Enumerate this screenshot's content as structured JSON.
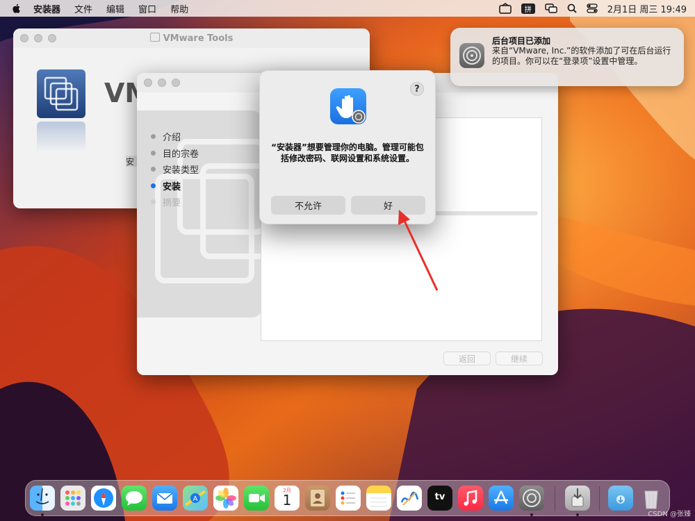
{
  "menubar": {
    "app_name": "安装器",
    "items": [
      "文件",
      "编辑",
      "窗口",
      "帮助"
    ],
    "ime": "拼",
    "datetime": "2月1日 周三  19:49"
  },
  "vmware_window": {
    "title": "VMware Tools",
    "brand_partial": "VM",
    "label_partial": "安"
  },
  "installer": {
    "steps": [
      {
        "label": "介绍",
        "state": "done"
      },
      {
        "label": "目的宗卷",
        "state": "done"
      },
      {
        "label": "安装类型",
        "state": "done"
      },
      {
        "label": "安装",
        "state": "current"
      },
      {
        "label": "摘要",
        "state": "disabled"
      }
    ],
    "back_label": "返回",
    "continue_label": "继续"
  },
  "dialog": {
    "help": "?",
    "message": "“安装器”想要管理你的电脑。管理可能包括修改密码、联网设置和系统设置。",
    "deny_label": "不允许",
    "ok_label": "好"
  },
  "notification": {
    "title": "后台项目已添加",
    "body": "来自“VMware, Inc.”的软件添加了可在后台运行的项目。你可以在“登录项”设置中管理。"
  },
  "dock": {
    "calendar_month": "2月",
    "calendar_day": "1",
    "tv_label": "tv"
  },
  "watermark": "CSDN @张臻"
}
